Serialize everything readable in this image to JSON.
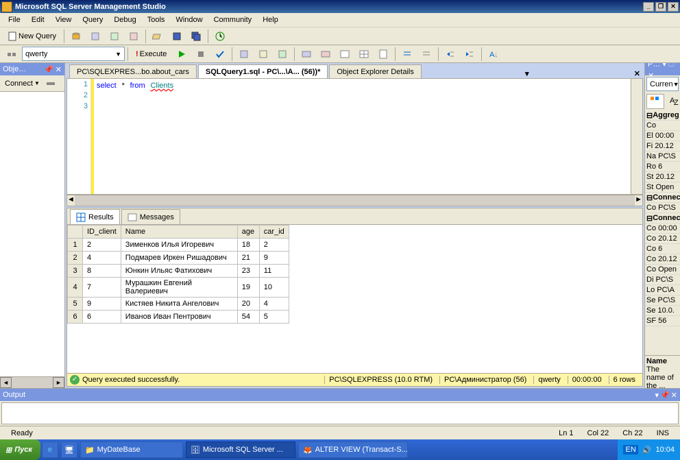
{
  "title": "Microsoft SQL Server Management Studio",
  "menu": [
    "File",
    "Edit",
    "View",
    "Query",
    "Debug",
    "Tools",
    "Window",
    "Community",
    "Help"
  ],
  "toolbar1": {
    "newquery": "New Query"
  },
  "toolbar2": {
    "db": "qwerty",
    "execute": "Execute"
  },
  "leftpane": {
    "title": "Obje…",
    "connect": "Connect"
  },
  "tabs": [
    {
      "label": "PC\\SQLEXPRES...bo.about_cars",
      "active": false
    },
    {
      "label": "SQLQuery1.sql - PC\\...\\А... (56))*",
      "active": true
    },
    {
      "label": "Object Explorer Details",
      "active": false
    }
  ],
  "sql": {
    "lines": [
      "1",
      "2",
      "3"
    ],
    "kw1": "select",
    "star": "*",
    "kw2": "from",
    "tbl": "Clients"
  },
  "results": {
    "tabs": {
      "results": "Results",
      "messages": "Messages"
    },
    "cols": [
      "",
      "ID_client",
      "Name",
      "age",
      "car_id"
    ],
    "rows": [
      [
        "1",
        "2",
        "Зименков Илья Игоревич",
        "18",
        "2"
      ],
      [
        "2",
        "4",
        "Подмарев Иркен Ришадович",
        "21",
        "9"
      ],
      [
        "3",
        "8",
        "Юнкин Ильяс Фатихович",
        "23",
        "11"
      ],
      [
        "4",
        "7",
        "Мурашкин Евгений Валериевич",
        "19",
        "10"
      ],
      [
        "5",
        "9",
        "Кистяев Никита Ангелович",
        "20",
        "4"
      ],
      [
        "6",
        "6",
        "Иванов Иван Пентрович",
        "54",
        "5"
      ]
    ]
  },
  "qstatus": {
    "msg": "Query executed successfully.",
    "server": "PC\\SQLEXPRESS (10.0 RTM)",
    "user": "PC\\Администратор (56)",
    "db": "qwerty",
    "time": "00:00:00",
    "rows": "6 rows"
  },
  "rightpane": {
    "title": "P… ▾ 🗆 ✕",
    "current": "Curren",
    "groups": {
      "agg": "Aggreg",
      "conn1": "Connec",
      "conn2": "Connec"
    },
    "rows": [
      "Co",
      "El 00:00",
      "Fi 20.12",
      "Na PC\\S",
      "Ro 6",
      "St 20.12",
      "St Open",
      "Co PC\\S",
      "Co 00:00",
      "Co 20.12",
      "Co 6",
      "Co 20.12",
      "Co Open",
      "Di PC\\S",
      "Lo PC\\А",
      "Se PC\\S",
      "Se 10.0.",
      "SF 56"
    ],
    "desc": {
      "title": "Name",
      "text": "The name of the ..."
    }
  },
  "output": {
    "title": "Output"
  },
  "status": {
    "ready": "Ready",
    "ln": "Ln 1",
    "col": "Col 22",
    "ch": "Ch 22",
    "ins": "INS"
  },
  "taskbar": {
    "start": "Пуск",
    "items": [
      {
        "label": "MyDateBase",
        "active": false
      },
      {
        "label": "Microsoft SQL Server ...",
        "active": true
      },
      {
        "label": "ALTER VIEW (Transact-S...",
        "active": false
      }
    ],
    "tray": {
      "lang": "EN",
      "time": "10:04"
    }
  }
}
